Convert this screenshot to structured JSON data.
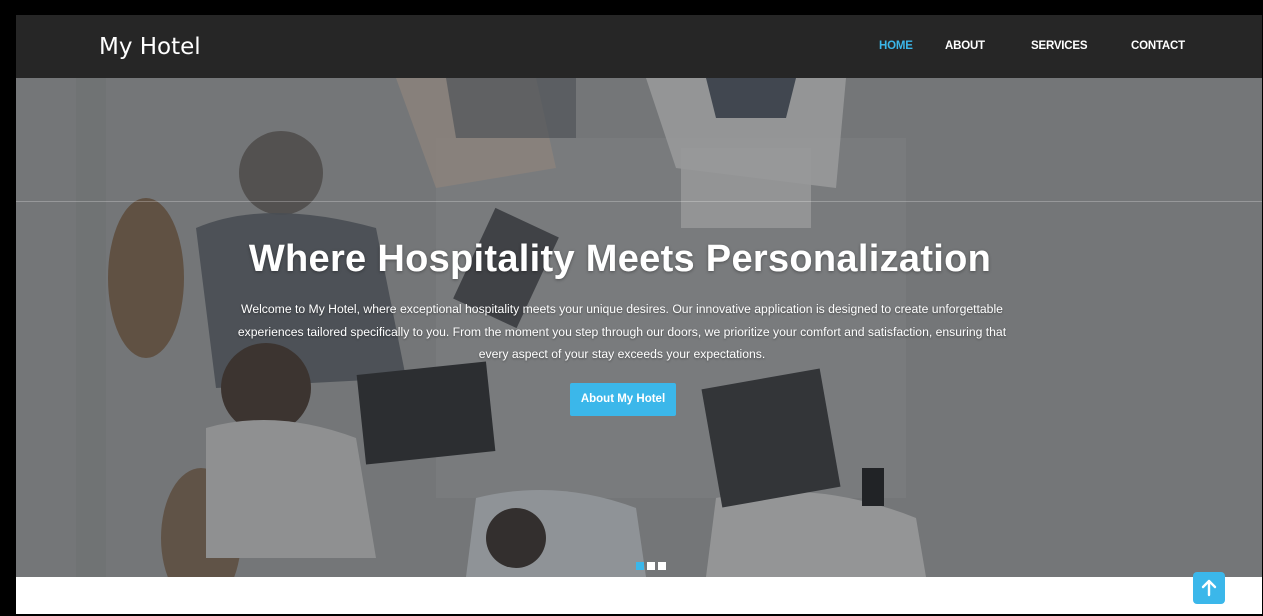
{
  "brand": {
    "name": "My Hotel"
  },
  "nav": {
    "items": [
      {
        "label": "HOME",
        "active": true
      },
      {
        "label": "ABOUT",
        "active": false
      },
      {
        "label": "SERVICES",
        "active": false
      },
      {
        "label": "CONTACT",
        "active": false
      }
    ]
  },
  "hero": {
    "title": "Where Hospitality Meets Personalization",
    "description": "Welcome to My Hotel, where exceptional hospitality meets your unique desires. Our innovative application is designed to create unforgettable experiences tailored specifically to you. From the moment you step through our doors, we prioritize your comfort and satisfaction, ensuring that every aspect of your stay exceeds your expectations.",
    "button_label": "About My Hotel",
    "background_image": "business-meeting-top-view-photo"
  },
  "carousel": {
    "slide_count": 3,
    "active_index": 0
  },
  "scroll_top": {
    "icon": "arrow-up-icon"
  },
  "colors": {
    "accent": "#3bb7ea",
    "navbar": "#262626",
    "text": "#ffffff"
  }
}
